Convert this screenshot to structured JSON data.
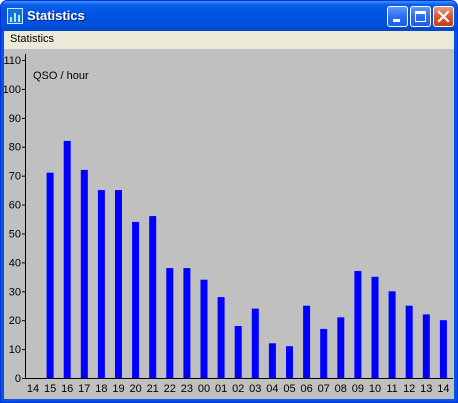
{
  "window": {
    "title": "Statistics",
    "menu": [
      "Statistics"
    ],
    "controls": [
      "minimize",
      "maximize",
      "close"
    ]
  },
  "colors": {
    "titlebar": "#0054e3",
    "chart_background": "#c0c0c0",
    "bar": "#0000ff",
    "menubar": "#ece9d8"
  },
  "chart_data": {
    "type": "bar",
    "title": "QSO / hour",
    "categories": [
      "14",
      "15",
      "16",
      "17",
      "18",
      "19",
      "20",
      "21",
      "22",
      "23",
      "00",
      "01",
      "02",
      "03",
      "04",
      "05",
      "06",
      "07",
      "08",
      "09",
      "10",
      "11",
      "12",
      "13",
      "14"
    ],
    "values": [
      0,
      71,
      82,
      72,
      65,
      65,
      54,
      56,
      38,
      38,
      34,
      28,
      18,
      24,
      12,
      11,
      25,
      17,
      21,
      37,
      35,
      30,
      25,
      22,
      20
    ],
    "yticks": [
      0,
      10,
      20,
      30,
      40,
      50,
      60,
      70,
      80,
      90,
      100,
      110
    ],
    "ylim": [
      0,
      110
    ],
    "xlabel": "",
    "ylabel": "",
    "grid": false,
    "legend": false
  }
}
